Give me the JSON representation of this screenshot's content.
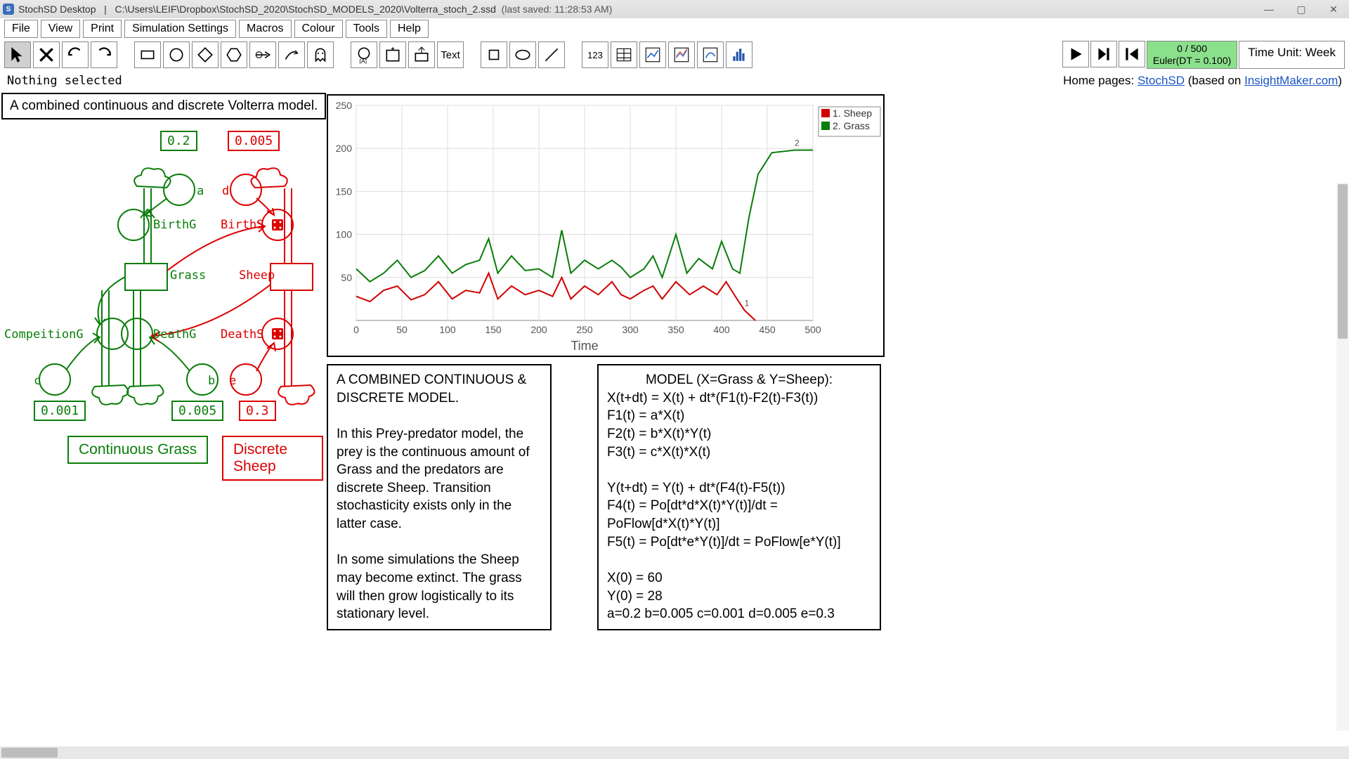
{
  "titlebar": {
    "app_name": "StochSD Desktop",
    "separator": "|",
    "path": "C:\\Users\\LEIF\\Dropbox\\StochSD_2020\\StochSD_MODELS_2020\\Volterra_stoch_2.ssd",
    "saved": "(last saved: 11:28:53 AM)"
  },
  "menu": {
    "file": "File",
    "view": "View",
    "print": "Print",
    "sim_settings": "Simulation Settings",
    "macros": "Macros",
    "colour": "Colour",
    "tools": "Tools",
    "help": "Help"
  },
  "toolbar": {
    "text_tool": "Text",
    "num_tool": "123",
    "solver_line1": "0 / 500",
    "solver_line2": "Euler(DT = 0.100)",
    "time_unit": "Time Unit: Week"
  },
  "status": {
    "selection": "Nothing selected",
    "home_prefix": "Home pages: ",
    "link1": "StochSD",
    "mid": " (based on ",
    "link2": "InsightMaker.com",
    "suffix": ")"
  },
  "caption": "A combined continuous and discrete Volterra model.",
  "diagram": {
    "a_val": "0.2",
    "d_val": "0.005",
    "c_val": "0.001",
    "b_val": "0.005",
    "e_val": "0.3",
    "birth_g": "BirthG",
    "birth_s": "BirthS",
    "grass": "Grass",
    "sheep": "Sheep",
    "comp_g": "CompeitionG",
    "death_g": "DeathG",
    "death_s": "DeathS",
    "a": "a",
    "b": "b",
    "c": "c",
    "d": "d",
    "e": "e",
    "cont_grass": "Continuous Grass",
    "disc_sheep": "Discrete Sheep"
  },
  "chart_data": {
    "type": "line",
    "title": "",
    "xlabel": "Time",
    "ylabel": "",
    "xlim": [
      0,
      500
    ],
    "ylim": [
      0,
      250
    ],
    "xticks": [
      0,
      50,
      100,
      150,
      200,
      250,
      300,
      350,
      400,
      450,
      500
    ],
    "yticks": [
      50,
      100,
      150,
      200,
      250
    ],
    "series": [
      {
        "name": "1. Sheep",
        "color": "#d00000",
        "x": [
          0,
          15,
          30,
          45,
          60,
          75,
          90,
          105,
          120,
          135,
          145,
          155,
          170,
          185,
          200,
          215,
          225,
          235,
          250,
          265,
          280,
          290,
          300,
          315,
          325,
          335,
          350,
          365,
          380,
          395,
          405,
          415,
          425,
          437
        ],
        "y": [
          28,
          22,
          35,
          40,
          24,
          30,
          45,
          25,
          35,
          32,
          55,
          25,
          40,
          30,
          35,
          28,
          50,
          25,
          40,
          30,
          45,
          30,
          25,
          35,
          40,
          25,
          45,
          30,
          40,
          30,
          45,
          28,
          12,
          0
        ]
      },
      {
        "name": "2. Grass",
        "color": "#0a7d0a",
        "x": [
          0,
          15,
          30,
          45,
          60,
          75,
          90,
          105,
          120,
          135,
          145,
          155,
          170,
          185,
          200,
          215,
          225,
          235,
          250,
          265,
          280,
          290,
          300,
          315,
          325,
          335,
          350,
          362,
          375,
          390,
          400,
          412,
          420,
          430,
          440,
          455,
          480,
          500
        ],
        "y": [
          60,
          45,
          55,
          70,
          50,
          58,
          75,
          55,
          65,
          70,
          95,
          55,
          75,
          58,
          60,
          50,
          105,
          55,
          70,
          60,
          70,
          62,
          50,
          60,
          75,
          50,
          100,
          55,
          72,
          60,
          92,
          60,
          55,
          120,
          170,
          195,
          198,
          198
        ]
      }
    ],
    "legend": [
      "1. Sheep",
      "2. Grass"
    ]
  },
  "desc_panel": {
    "title": "A COMBINED CONTINUOUS & DISCRETE MODEL.",
    "p1": "In this Prey-predator model, the prey is the continuous amount of Grass and the predators are discrete Sheep. Transition stochasticity exists only in the latter case.",
    "p2": "In some simulations the Sheep may become extinct. The grass will then grow logistically to its stationary level."
  },
  "model_panel": {
    "title": "MODEL (X=Grass & Y=Sheep):",
    "l1": "X(t+dt) = X(t) + dt*(F1(t)-F2(t)-F3(t))",
    "l2": "F1(t) = a*X(t)",
    "l3": "F2(t) = b*X(t)*Y(t)",
    "l4": "F3(t) = c*X(t)*X(t)",
    "l5": "Y(t+dt) = Y(t) + dt*(F4(t)-F5(t))",
    "l6": "F4(t) = Po[dt*d*X(t)*Y(t)]/dt = PoFlow[d*X(t)*Y(t)]",
    "l7": "F5(t) = Po[dt*e*Y(t)]/dt = PoFlow[e*Y(t)]",
    "l8": "X(0) = 60",
    "l9": "Y(0) = 28",
    "l10": "a=0.2  b=0.005  c=0.001  d=0.005  e=0.3"
  }
}
